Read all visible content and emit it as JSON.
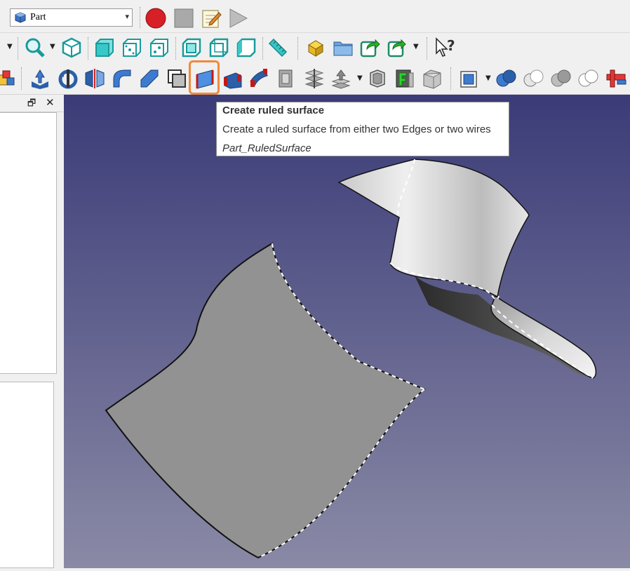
{
  "workbench": {
    "value": "Part"
  },
  "tooltip": {
    "title": "Create ruled surface",
    "description": "Create a ruled surface from either two Edges or two wires",
    "command": "Part_RuledSurface"
  },
  "colors": {
    "viewport_top": "#3b3b78",
    "viewport_bottom": "#8a8aa6",
    "surface_gray": "#929292",
    "highlight": "#f08a3c"
  }
}
